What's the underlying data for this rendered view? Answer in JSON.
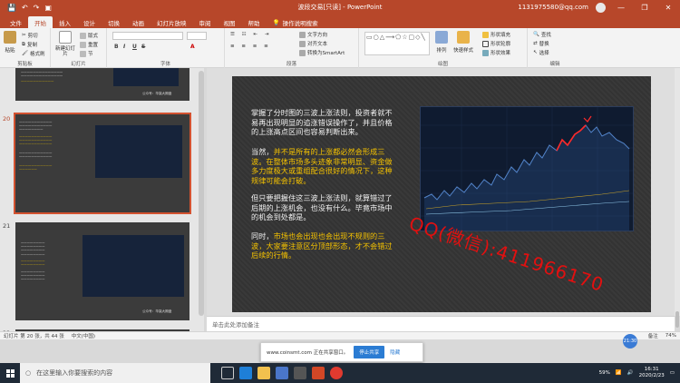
{
  "app": {
    "window_title": "波段交易[只读] - PowerPoint",
    "quick_access": [
      "💾",
      "↶",
      "↷",
      "▣"
    ],
    "user": "1131975580@qq.com",
    "window_buttons": [
      "—",
      "❐",
      "✕"
    ]
  },
  "tabs": [
    "文件",
    "开始",
    "插入",
    "设计",
    "切换",
    "动画",
    "幻灯片放映",
    "审阅",
    "视图",
    "帮助",
    "操作说明搜索"
  ],
  "ribbon": {
    "clipboard": {
      "paste": "粘贴",
      "cut": "剪切",
      "copy": "复制",
      "format_painter": "格式刷",
      "label": "剪贴板"
    },
    "slides": {
      "new_slide": "新建幻灯片",
      "layout": "版式",
      "reset": "重置",
      "section": "节",
      "label": "幻灯片"
    },
    "font": {
      "bold": "B",
      "italic": "I",
      "underline": "U",
      "strike": "S",
      "label": "字体"
    },
    "paragraph": {
      "text_direction": "文字方向",
      "align_text": "对齐文本",
      "smartart": "转换为SmartArt",
      "label": "段落"
    },
    "drawing": {
      "arrange": "排列",
      "quick_styles": "快速样式",
      "fill": "形状填充",
      "outline": "形状轮廓",
      "effects": "形状效果",
      "label": "绘图"
    },
    "editing": {
      "find": "查找",
      "replace": "替换",
      "select": "选择",
      "label": "编辑"
    }
  },
  "thumbnails": {
    "items": [
      {
        "num": "",
        "caption": "公众号：华赢大期盘"
      },
      {
        "num": "20",
        "caption": ""
      },
      {
        "num": "21",
        "caption": "公众号：华赢大期盘"
      },
      {
        "num": "22",
        "caption": ""
      }
    ]
  },
  "slide": {
    "paragraphs": [
      {
        "text": "掌握了分时图的三波上涨法则，投资者就不易再出现明显的追涨错误操作了，并且价格的上涨高点区间也容易判断出来。",
        "highlight": ""
      },
      {
        "text": "当然，",
        "highlight": "并不是所有的上涨都必然会形成三波。在整体市场多头迹象非常明显、资金做多力度极大或重组配合很好的情况下，这种规律可能会打破。"
      },
      {
        "text": "但只要把握住这三波上涨法则，就算错过了后期的上涨机会，也没有什么。毕竟市场中的机会到处都是。",
        "highlight": ""
      },
      {
        "text": "同时，",
        "highlight": "市场也会出现也会出现不规则的三波，大家要注意区分顶部形态，才不会错过后续的行情。"
      }
    ],
    "watermark": "QQ(微信):411966170"
  },
  "notes_placeholder": "单击此处添加备注",
  "status": {
    "slide_info": "幻灯片 第 20 张，共 44 张",
    "language": "中文(中国)",
    "notes": "备注",
    "zoom": "74%"
  },
  "popup": {
    "text": "www.coinsmt.com 正在共享窗口。",
    "stop_button": "停止共享",
    "hide_link": "隐藏"
  },
  "zoom_bubble": "21:30",
  "taskbar": {
    "search_placeholder": "在这里输入你要搜索的内容",
    "battery": "59%",
    "time": "16:31",
    "date": "2020/2/23"
  },
  "colors": {
    "accent": "#b7472a",
    "highlight_text": "#f5c200",
    "watermark": "#e11010"
  }
}
